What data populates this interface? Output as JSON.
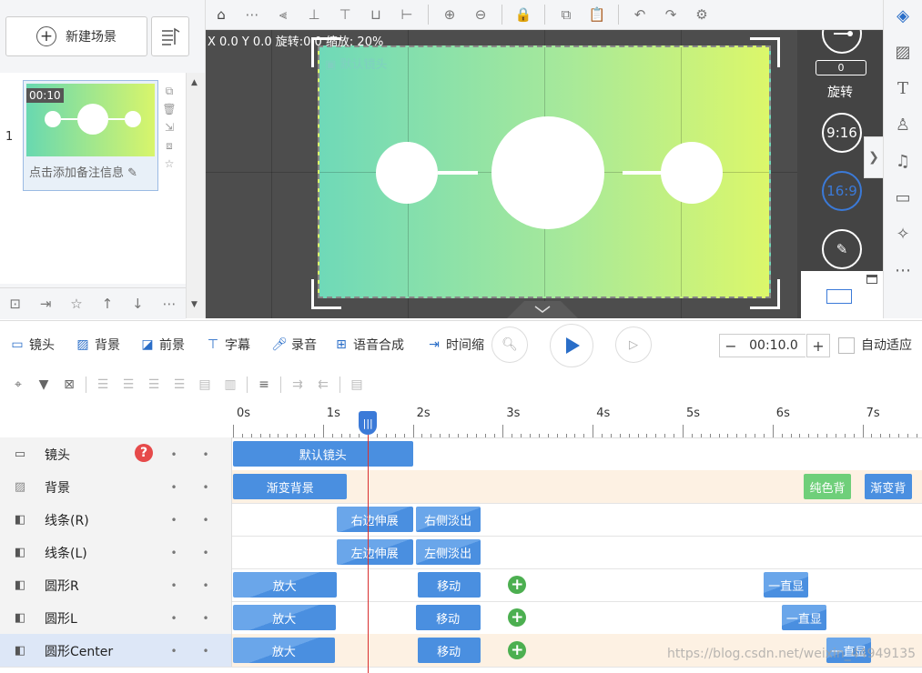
{
  "left_panel": {
    "new_scene_label": "新建场景",
    "scene": {
      "number": "1",
      "duration": "00:10",
      "note_placeholder": "点击添加备注信息"
    }
  },
  "canvas": {
    "coord_text": "X 0.0 Y 0.0 旋转:0.0 缩放: 20%",
    "camera_label": "默认镜头",
    "rotate_value": "0",
    "rotate_label": "旋转",
    "ratio_916": "9:16",
    "ratio_169": "16:9"
  },
  "toolbar": {
    "items": [
      {
        "label": "镜头",
        "icon": "camera-icon"
      },
      {
        "label": "背景",
        "icon": "background-icon"
      },
      {
        "label": "前景",
        "icon": "foreground-icon"
      },
      {
        "label": "字幕",
        "icon": "subtitle-icon"
      },
      {
        "label": "录音",
        "icon": "mic-icon"
      },
      {
        "label": "语音合成",
        "icon": "tts-icon"
      },
      {
        "label": "时间缩",
        "icon": "time-scale-icon"
      }
    ],
    "duration_value": "00:10.0",
    "auto_fit_label": "自动适应"
  },
  "timeline": {
    "ruler_labels": [
      "0s",
      "1s",
      "2s",
      "3s",
      "4s",
      "5s",
      "6s",
      "7s"
    ],
    "playhead_time": 1.5,
    "tracks": [
      {
        "label": "镜头",
        "icon": "camera-icon",
        "clips": [
          {
            "text": "默认镜头",
            "start": 0,
            "end": 2,
            "style": "blue"
          }
        ],
        "keyframes": []
      },
      {
        "label": "背景",
        "icon": "background-icon",
        "clips": [
          {
            "text": "渐变背景",
            "start": 0,
            "end": 1.27,
            "style": "blue"
          },
          {
            "text": "纯色背",
            "start": 6.35,
            "end": 6.87,
            "style": "green"
          },
          {
            "text": "渐变背",
            "start": 7.02,
            "end": 7.55,
            "style": "blue"
          }
        ],
        "keyframes": []
      },
      {
        "label": "线条(R)",
        "icon": "element-icon",
        "clips": [
          {
            "text": "右边伸展",
            "start": 1.15,
            "end": 2.0,
            "style": "slant"
          },
          {
            "text": "右侧淡出",
            "start": 2.03,
            "end": 2.75,
            "style": "slant"
          }
        ],
        "keyframes": []
      },
      {
        "label": "线条(L)",
        "icon": "element-icon",
        "clips": [
          {
            "text": "左边伸展",
            "start": 1.15,
            "end": 2.0,
            "style": "slant"
          },
          {
            "text": "左侧淡出",
            "start": 2.03,
            "end": 2.75,
            "style": "slant"
          }
        ],
        "keyframes": []
      },
      {
        "label": "圆形R",
        "icon": "element-icon",
        "clips": [
          {
            "text": "放大",
            "start": 0,
            "end": 1.15,
            "style": "slant"
          },
          {
            "text": "移动",
            "start": 2.05,
            "end": 2.75,
            "style": "blue"
          },
          {
            "text": "一直显",
            "start": 5.9,
            "end": 6.4,
            "style": "slant"
          }
        ],
        "keyframes": [
          3.16
        ]
      },
      {
        "label": "圆形L",
        "icon": "element-icon",
        "clips": [
          {
            "text": "放大",
            "start": 0,
            "end": 1.14,
            "style": "slant"
          },
          {
            "text": "移动",
            "start": 2.03,
            "end": 2.75,
            "style": "blue"
          },
          {
            "text": "一直显",
            "start": 6.1,
            "end": 6.6,
            "style": "slant"
          }
        ],
        "keyframes": [
          3.16
        ]
      },
      {
        "label": "圆形Center",
        "icon": "element-icon",
        "clips": [
          {
            "text": "放大",
            "start": 0,
            "end": 1.13,
            "style": "slant"
          },
          {
            "text": "移动",
            "start": 2.05,
            "end": 2.75,
            "style": "blue"
          },
          {
            "text": "一直显",
            "start": 6.6,
            "end": 7.1,
            "style": "slant"
          }
        ],
        "keyframes": [
          3.16
        ]
      }
    ]
  },
  "watermark": "https://blog.csdn.net/weixin_44949135"
}
